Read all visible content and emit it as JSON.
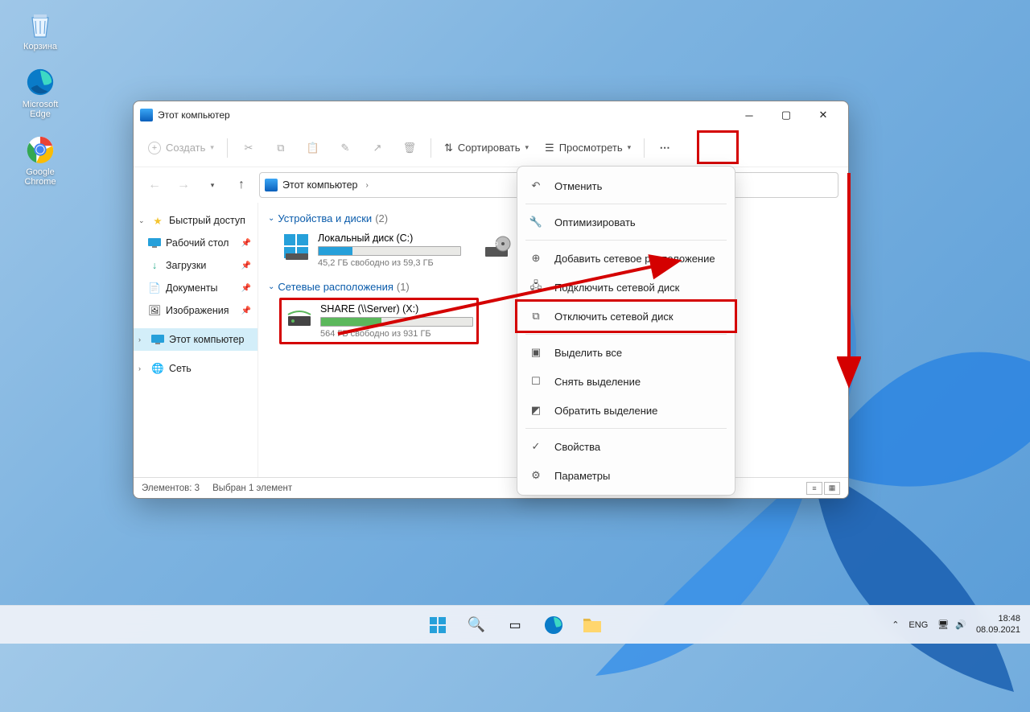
{
  "desktop": {
    "icons": [
      {
        "name": "recycle-bin",
        "label": "Корзина"
      },
      {
        "name": "microsoft-edge",
        "label": "Microsoft Edge"
      },
      {
        "name": "google-chrome",
        "label": "Google Chrome"
      }
    ]
  },
  "window": {
    "title": "Этот компьютер",
    "toolbar": {
      "new": "Создать",
      "sort": "Сортировать",
      "view": "Просмотреть"
    },
    "breadcrumb": "Этот компьютер",
    "sidebar": {
      "quick_access": "Быстрый доступ",
      "desktop": "Рабочий стол",
      "downloads": "Загрузки",
      "documents": "Документы",
      "pictures": "Изображения",
      "this_pc": "Этот компьютер",
      "network": "Сеть"
    },
    "content": {
      "group1": {
        "title": "Устройства и диски",
        "count": "(2)"
      },
      "group2": {
        "title": "Сетевые расположения",
        "count": "(1)"
      },
      "drive_c": {
        "name": "Локальный диск (C:)",
        "free": "45,2 ГБ свободно из 59,3 ГБ",
        "fill_pct": 24
      },
      "drive_dvd": {
        "name": "",
        "visible_label": ""
      },
      "drive_x": {
        "name": "SHARE (\\\\Server) (X:)",
        "free": "564 ГБ свободно из 931 ГБ",
        "fill_pct": 40
      }
    },
    "statusbar": {
      "items": "Элементов: 3",
      "selected": "Выбран 1 элемент"
    }
  },
  "context_menu": {
    "undo": "Отменить",
    "optimize": "Оптимизировать",
    "add_network_location": "Добавить сетевое расположение",
    "map_network_drive": "Подключить сетевой диск",
    "disconnect_network_drive": "Отключить сетевой диск",
    "select_all": "Выделить все",
    "select_none": "Снять выделение",
    "invert_selection": "Обратить выделение",
    "properties": "Свойства",
    "options": "Параметры"
  },
  "taskbar": {
    "lang": "ENG",
    "time": "18:48",
    "date": "08.09.2021"
  }
}
